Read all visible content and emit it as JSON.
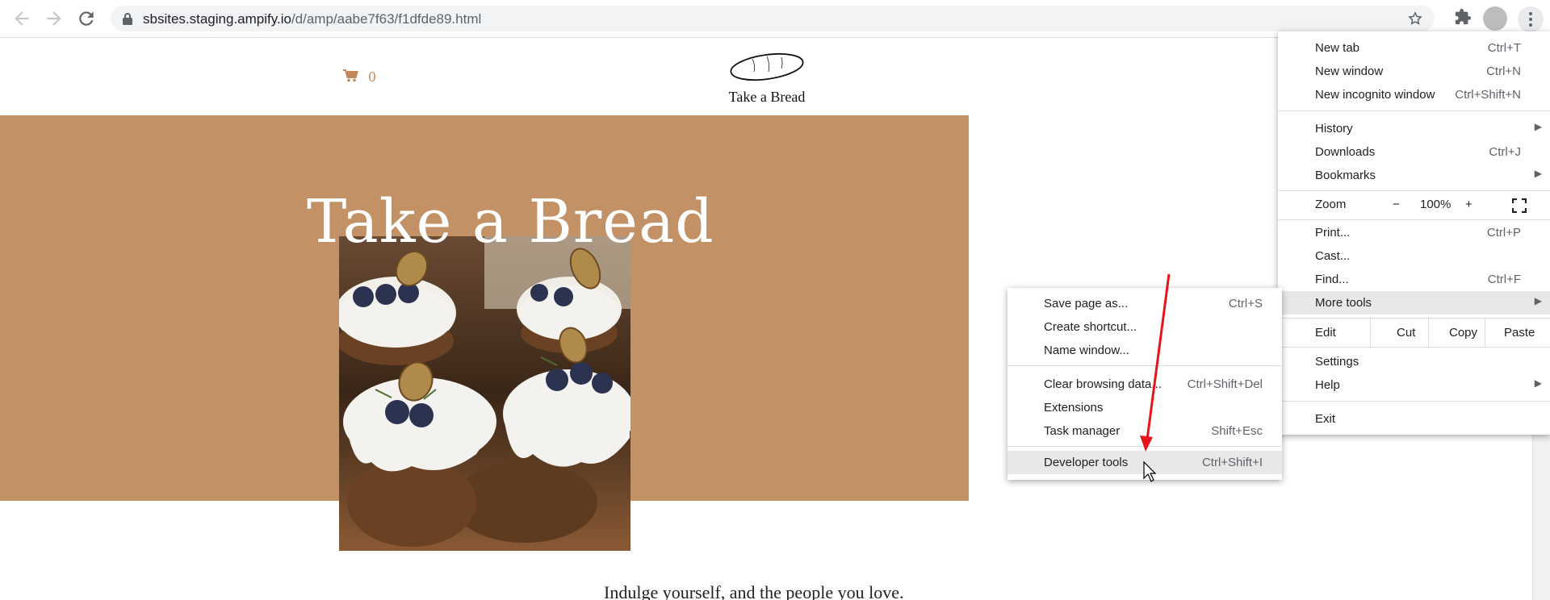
{
  "browser": {
    "url_host": "sbsites.staging.ampify.io",
    "url_path": "/d/amp/aabe7f63/f1dfde89.html"
  },
  "site": {
    "cart_count": "0",
    "logo_text": "Take a Bread",
    "hero_title": "Take a Bread",
    "tagline": "Indulge yourself, and the people you love."
  },
  "menu": {
    "new_tab": {
      "label": "New tab",
      "shortcut": "Ctrl+T"
    },
    "new_window": {
      "label": "New window",
      "shortcut": "Ctrl+N"
    },
    "new_incognito": {
      "label": "New incognito window",
      "shortcut": "Ctrl+Shift+N"
    },
    "history": {
      "label": "History"
    },
    "downloads": {
      "label": "Downloads",
      "shortcut": "Ctrl+J"
    },
    "bookmarks": {
      "label": "Bookmarks"
    },
    "zoom": {
      "label": "Zoom",
      "minus": "−",
      "value": "100%",
      "plus": "+"
    },
    "print": {
      "label": "Print...",
      "shortcut": "Ctrl+P"
    },
    "cast": {
      "label": "Cast..."
    },
    "find": {
      "label": "Find...",
      "shortcut": "Ctrl+F"
    },
    "more_tools": {
      "label": "More tools"
    },
    "edit": {
      "label": "Edit",
      "cut": "Cut",
      "copy": "Copy",
      "paste": "Paste"
    },
    "settings": {
      "label": "Settings"
    },
    "help": {
      "label": "Help"
    },
    "exit": {
      "label": "Exit"
    }
  },
  "submenu": {
    "save_page": {
      "label": "Save page as...",
      "shortcut": "Ctrl+S"
    },
    "create_shortcut": {
      "label": "Create shortcut..."
    },
    "name_window": {
      "label": "Name window..."
    },
    "clear_data": {
      "label": "Clear browsing data...",
      "shortcut": "Ctrl+Shift+Del"
    },
    "extensions": {
      "label": "Extensions"
    },
    "task_manager": {
      "label": "Task manager",
      "shortcut": "Shift+Esc"
    },
    "dev_tools": {
      "label": "Developer tools",
      "shortcut": "Ctrl+Shift+I"
    }
  },
  "colors": {
    "hero_band": "#c29266",
    "accent": "#c0885a",
    "annotation_arrow": "#e8141c",
    "menu_highlight": "#e8e8e8"
  },
  "icons": [
    "back-icon",
    "forward-icon",
    "reload-icon",
    "lock-icon",
    "star-icon",
    "extensions-icon",
    "avatar",
    "kebab-menu-icon",
    "cart-icon",
    "bread-logo-icon",
    "fullscreen-icon",
    "submenu-arrow-icon",
    "cursor-icon"
  ]
}
